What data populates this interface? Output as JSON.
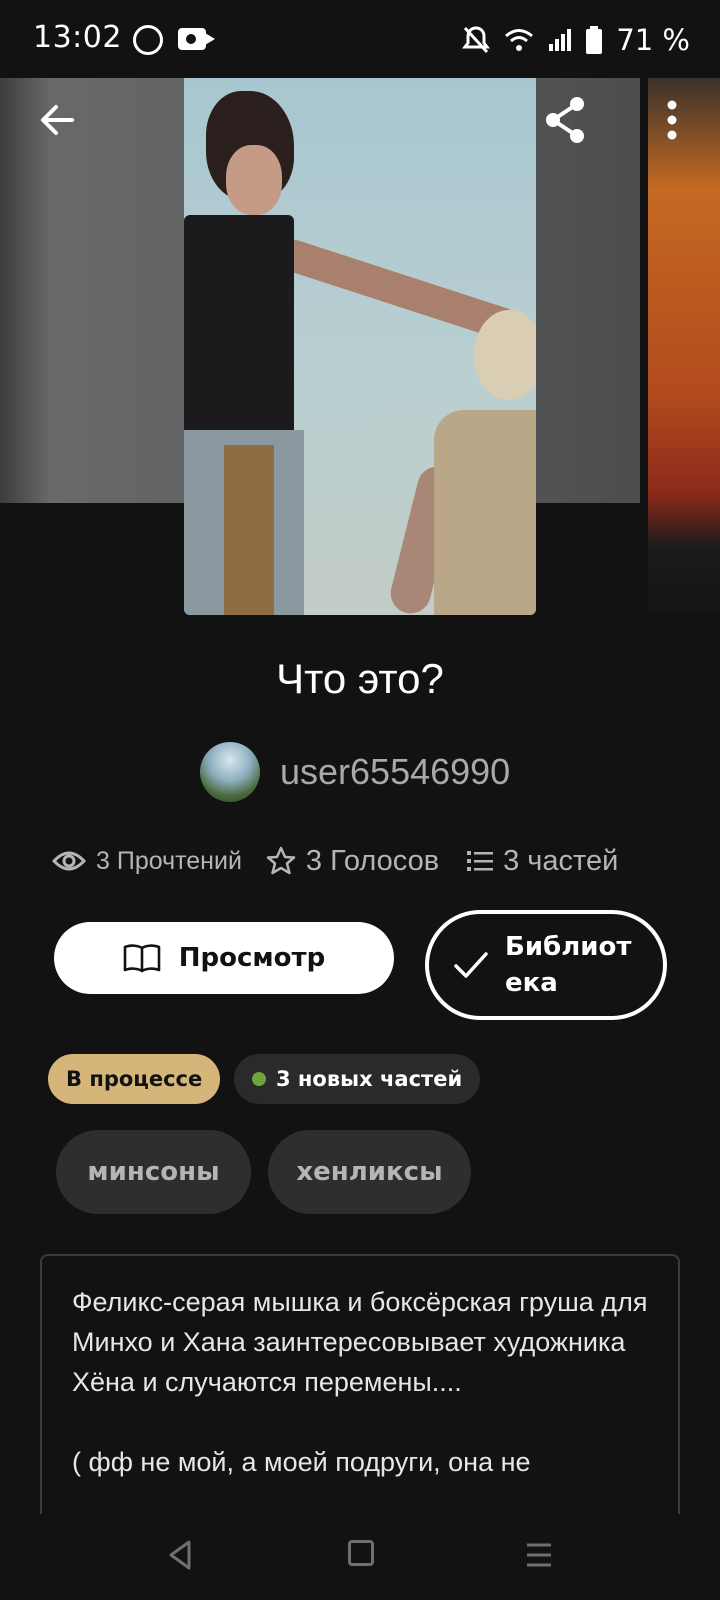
{
  "status_bar": {
    "time": "13:02",
    "battery": "71 %",
    "icons": [
      "walk-icon",
      "video-camera-icon",
      "bell-off-icon",
      "wifi-icon",
      "signal-icon",
      "battery-icon"
    ]
  },
  "top_bar": {
    "icons": [
      "back-arrow-icon",
      "share-icon",
      "more-vertical-icon"
    ]
  },
  "story": {
    "title": "Что это?",
    "author": "user65546990",
    "stats": {
      "reads": "3 Прочтений",
      "votes": "3 Голосов",
      "parts": "3 частей"
    },
    "read_button": "Просмотр",
    "library_button": "Библиотека",
    "status_label": "В процессе",
    "new_parts_label": "3 новых частей",
    "tags": [
      "минсоны",
      "хенликсы"
    ],
    "description": "Феликс-серая мышка и боксёрская груша для Минхо и Хана заинтересовывает художника Хёна и случаются перемены....\n\n( фф не мой, а моей подруги, она не"
  },
  "colors": {
    "background": "#121212",
    "status_pill": "#d6b57a",
    "new_dot": "#6ea53a",
    "tag_bg": "#2e2e2e"
  }
}
